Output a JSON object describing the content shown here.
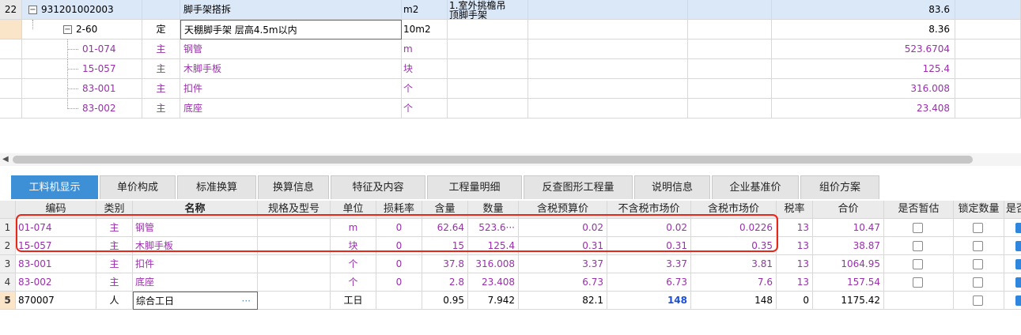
{
  "upper_grid": {
    "rows": [
      {
        "row_no": "22",
        "code": "931201002003",
        "type": "",
        "name": "脚手架搭拆",
        "unit": "m2",
        "feature": "1.室外挑檐吊\n顶脚手架",
        "quantity": "83.6"
      },
      {
        "row_no": "",
        "code": "2-60",
        "type": "定",
        "name": "天棚脚手架 层高4.5m以内",
        "unit": "10m2",
        "feature": "",
        "quantity": "8.36"
      },
      {
        "row_no": "",
        "code": "01-074",
        "type": "主",
        "name": "钢管",
        "unit": "m",
        "feature": "",
        "quantity": "523.6704"
      },
      {
        "row_no": "",
        "code": "15-057",
        "type": "主",
        "name": "木脚手板",
        "unit": "块",
        "feature": "",
        "quantity": "125.4"
      },
      {
        "row_no": "",
        "code": "83-001",
        "type": "主",
        "name": "扣件",
        "unit": "个",
        "feature": "",
        "quantity": "316.008"
      },
      {
        "row_no": "",
        "code": "83-002",
        "type": "主",
        "name": "底座",
        "unit": "个",
        "feature": "",
        "quantity": "23.408"
      }
    ]
  },
  "tabs": [
    "工料机显示",
    "单价构成",
    "标准换算",
    "换算信息",
    "特征及内容",
    "工程量明细",
    "反查图形工程量",
    "说明信息",
    "企业基准价",
    "组价方案"
  ],
  "lower_grid": {
    "headers": [
      "编码",
      "类别",
      "名称",
      "规格及型号",
      "单位",
      "损耗率",
      "含量",
      "数量",
      "含税预算价",
      "不含税市场价",
      "含税市场价",
      "税率",
      "合价",
      "是否暂估",
      "锁定数量",
      "是否"
    ],
    "rows": [
      {
        "no": "1",
        "code": "01-074",
        "type": "主",
        "name": "钢管",
        "spec": "",
        "unit": "m",
        "loss": "0",
        "content": "62.64",
        "qty": "523.6···",
        "tax_budget": "0.02",
        "notax_market": "0.02",
        "tax_market": "0.0226",
        "rate": "13",
        "total": "10.47"
      },
      {
        "no": "2",
        "code": "15-057",
        "type": "主",
        "name": "木脚手板",
        "spec": "",
        "unit": "块",
        "loss": "0",
        "content": "15",
        "qty": "125.4",
        "tax_budget": "0.31",
        "notax_market": "0.31",
        "tax_market": "0.35",
        "rate": "13",
        "total": "38.87"
      },
      {
        "no": "3",
        "code": "83-001",
        "type": "主",
        "name": "扣件",
        "spec": "",
        "unit": "个",
        "loss": "0",
        "content": "37.8",
        "qty": "316.008",
        "tax_budget": "3.37",
        "notax_market": "3.37",
        "tax_market": "3.81",
        "rate": "13",
        "total": "1064.95"
      },
      {
        "no": "4",
        "code": "83-002",
        "type": "主",
        "name": "底座",
        "spec": "",
        "unit": "个",
        "loss": "0",
        "content": "2.8",
        "qty": "23.408",
        "tax_budget": "6.73",
        "notax_market": "6.73",
        "tax_market": "7.6",
        "rate": "13",
        "total": "157.54"
      },
      {
        "no": "5",
        "code": "870007",
        "type": "人",
        "name": "综合工日",
        "name_ellipsis": "···",
        "spec": "",
        "unit": "工日",
        "loss": "",
        "content": "0.95",
        "qty": "7.942",
        "tax_budget": "82.1",
        "notax_market": "148",
        "tax_market": "148",
        "rate": "0",
        "total": "1175.42"
      }
    ]
  },
  "colors": {
    "accent": "#3d8fd6",
    "purple_text": "#9b2fae",
    "highlight_box": "#e8261a",
    "selected_row": "#dbe8f8"
  }
}
